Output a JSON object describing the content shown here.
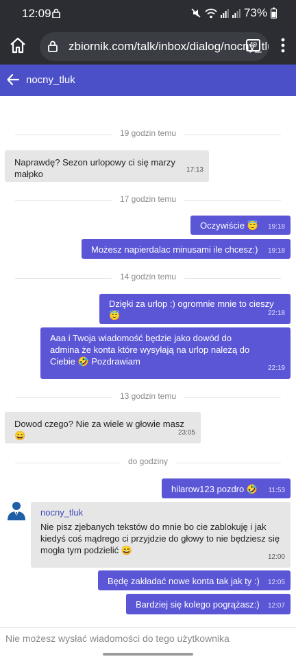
{
  "status_bar": {
    "time": "12:09",
    "battery": "73%"
  },
  "browser": {
    "url": "zbiornik.com/talk/inbox/dialog/nocny_tluk",
    "tabs_count": "49"
  },
  "chat": {
    "title": "nocny_tluk"
  },
  "messages": [
    {
      "type": "separator",
      "label": "19 godzin temu"
    },
    {
      "type": "in",
      "text": "Naprawdę? Sezon urlopowy ci się marzy małpko",
      "time": "17:13"
    },
    {
      "type": "separator",
      "label": "17 godzin temu"
    },
    {
      "type": "out",
      "text": "Oczywiście 😇",
      "time": "19:18"
    },
    {
      "type": "out",
      "text": "Możesz napierdalac minusami ile chcesz:)",
      "time": "19:18"
    },
    {
      "type": "separator",
      "label": "14 godzin temu"
    },
    {
      "type": "out",
      "text": "Dzięki za urlop :) ogromnie mnie to cieszy 😇",
      "time": "22:18"
    },
    {
      "type": "out",
      "text": "Aaa i Twoja wiadomość będzie jako dowód do admina że konta które wysyłają na urlop należą do Ciebie 🤣 Pozdrawiam",
      "time": "22:19"
    },
    {
      "type": "separator",
      "label": "13 godzin temu"
    },
    {
      "type": "in",
      "text": "Dowod czego? Nie za wiele w głowie masz 😄",
      "time": "23:05"
    },
    {
      "type": "separator",
      "label": "do godziny"
    },
    {
      "type": "out",
      "text": "hilarow123 pozdro 🤣",
      "time": "11:53"
    },
    {
      "type": "in",
      "sender": "nocny_tluk",
      "text": "Nie pisz zjebanych tekstów do mnie bo cie zablokuję i jak kiedyś coś mądrego ci przyjdzie do głowy to nie będziesz się mogła tym podzielić 😄",
      "time": "12:00"
    },
    {
      "type": "out",
      "text": "Będę zakładać nowe konta tak jak ty :)",
      "time": "12:05"
    },
    {
      "type": "out",
      "text": "Bardziej się kolego pogrążasz:)",
      "time": "12:07"
    }
  ],
  "footer": {
    "notice": "Nie możesz wysłać wiadomości do tego użytkownika"
  },
  "colors": {
    "accent": "#4b50c8",
    "outgoing_bubble": "#5b56d6",
    "incoming_bubble": "#e6e6e6",
    "sender_name": "#3d47b8"
  }
}
